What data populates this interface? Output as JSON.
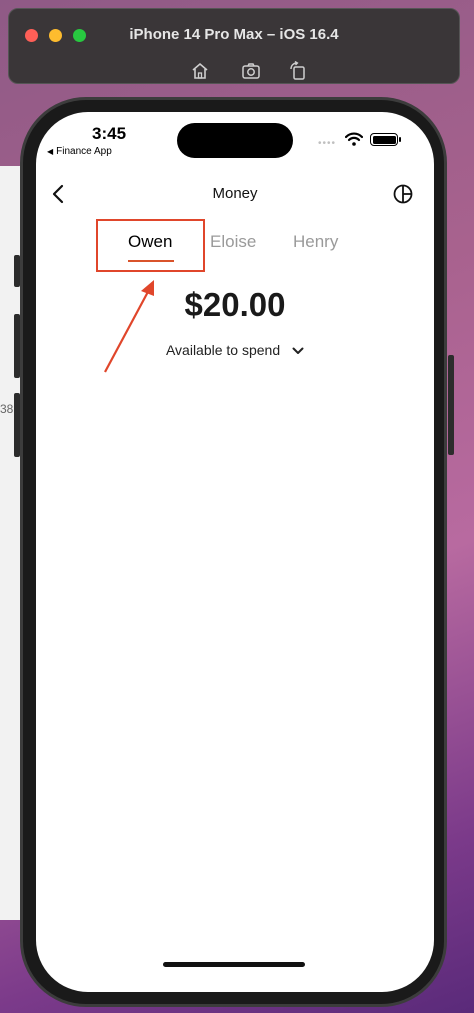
{
  "simulator": {
    "title": "iPhone 14 Pro Max – iOS 16.4",
    "toolbar_icons": [
      "home-icon",
      "screenshot-icon",
      "rotate-icon"
    ]
  },
  "background_window": {
    "partial_text": "38"
  },
  "status_bar": {
    "time": "3:45",
    "back_app": "Finance App"
  },
  "nav": {
    "title": "Money",
    "back_icon": "chevron-left-icon",
    "right_icon": "pie-chart-icon"
  },
  "tabs": [
    {
      "label": "Owen",
      "selected": true
    },
    {
      "label": "Eloise",
      "selected": false
    },
    {
      "label": "Henry",
      "selected": false
    }
  ],
  "balance": {
    "amount": "$20.00",
    "label": "Available to spend"
  },
  "colors": {
    "accent": "#d9532b",
    "annotation": "#e0462b",
    "inactive_tab": "#9a9a9a"
  }
}
